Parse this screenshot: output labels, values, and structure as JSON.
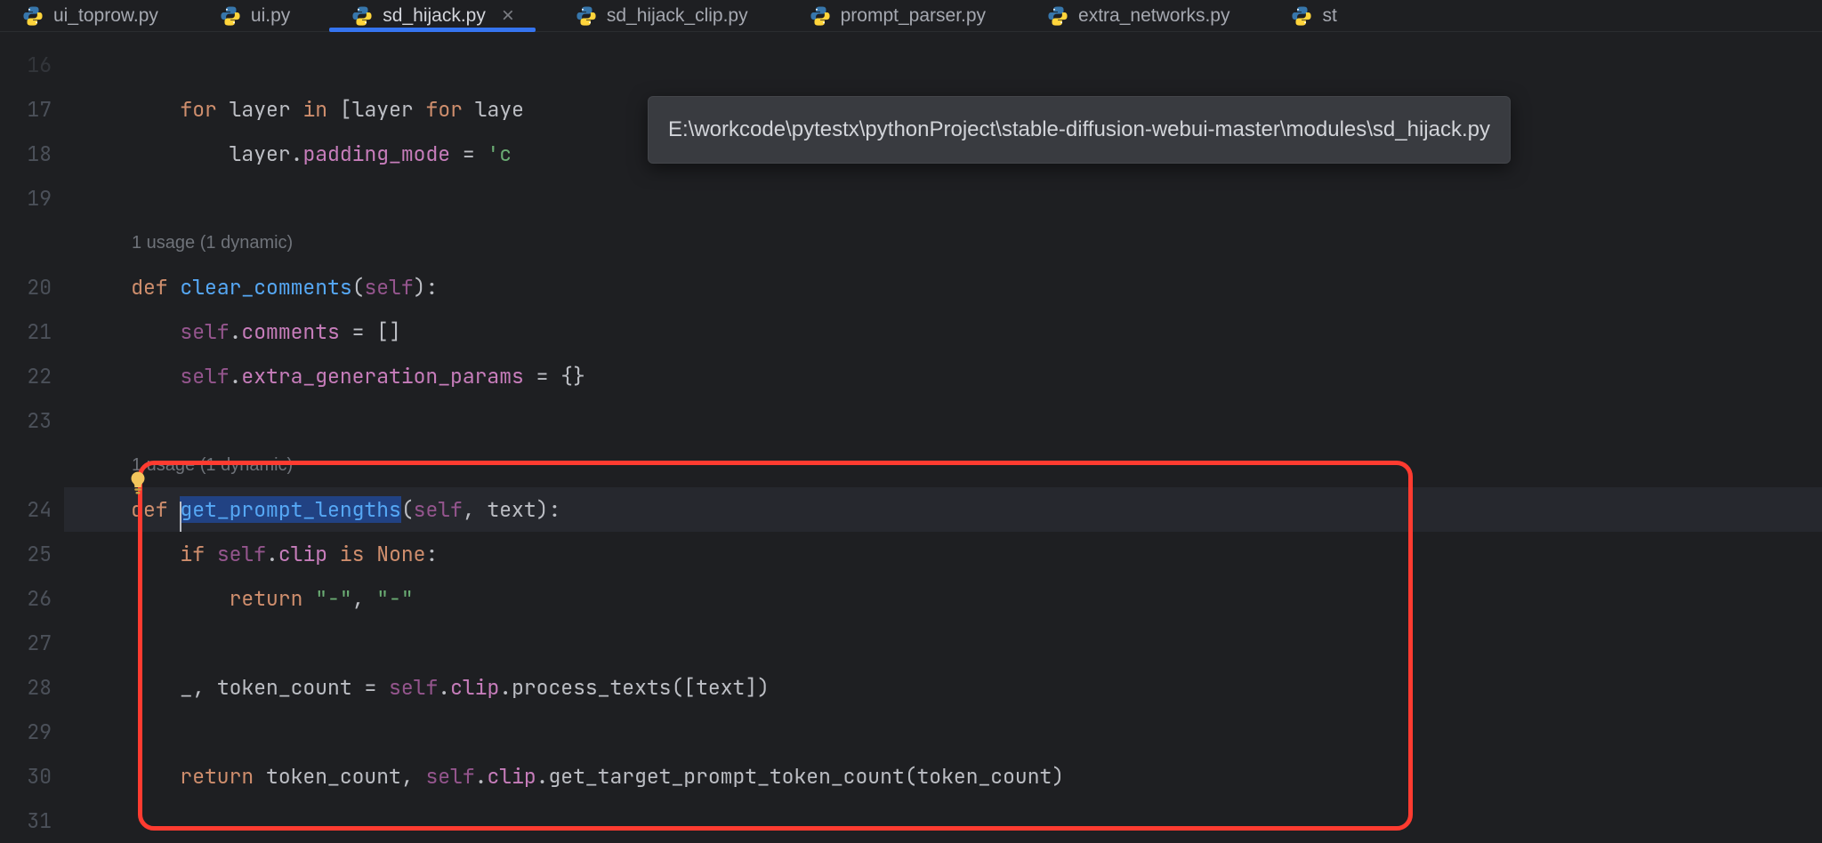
{
  "tooltip": "E:\\workcode\\pytestx\\pythonProject\\stable-diffusion-webui-master\\modules\\sd_hijack.py",
  "tabs": [
    {
      "label": "ui_toprow.py",
      "active": false,
      "closeable": false
    },
    {
      "label": "ui.py",
      "active": false,
      "closeable": false
    },
    {
      "label": "sd_hijack.py",
      "active": true,
      "closeable": true
    },
    {
      "label": "sd_hijack_clip.py",
      "active": false,
      "closeable": false
    },
    {
      "label": "prompt_parser.py",
      "active": false,
      "closeable": false
    },
    {
      "label": "extra_networks.py",
      "active": false,
      "closeable": false
    },
    {
      "label": "st",
      "active": false,
      "closeable": false
    }
  ],
  "line_numbers": [
    "16",
    "17",
    "18",
    "19",
    "",
    "20",
    "21",
    "22",
    "23",
    "",
    "24",
    "25",
    "26",
    "27",
    "28",
    "29",
    "30",
    "31"
  ],
  "usage_hint_1": "1 usage (1 dynamic)",
  "usage_hint_2": "1 usage (1 dynamic)",
  "code": {
    "l17": {
      "kw_for": "for",
      "id_layer": "layer",
      "kw_in": "in",
      "id_layer2": "layer",
      "kw_for2": "for",
      "id_layer3": "laye"
    },
    "l18": {
      "attr": "layer",
      "dot": ".",
      "attr2": "padding_mode",
      "eq": " = ",
      "str": "'c"
    },
    "l20": {
      "kw_def": "def",
      "fn": "clear_comments",
      "lp": "(",
      "self": "self",
      "rp": "):"
    },
    "l21": {
      "self": "self",
      "dot": ".",
      "attr": "comments",
      "eq": " = []"
    },
    "l22": {
      "self": "self",
      "dot": ".",
      "attr": "extra_generation_params",
      "eq": " = {}"
    },
    "l24": {
      "kw_def": "def",
      "fn": "get_prompt_lengths",
      "lp": "(",
      "self": "self",
      "comma": ", ",
      "param": "text",
      "rp": "):"
    },
    "l25": {
      "kw_if": "if",
      "self": "self",
      "dot": ".",
      "attr": "clip",
      "kw_is": "is",
      "none": "None",
      "colon": ":"
    },
    "l26": {
      "kw_return": "return",
      "s1": "\"-\"",
      "comma": ", ",
      "s2": "\"-\""
    },
    "l28": {
      "underscore": "_",
      "comma": ", ",
      "tc": "token_count",
      "eq": " = ",
      "self": "self",
      "d1": ".",
      "a1": "clip",
      "d2": ".",
      "m": "process_texts",
      "lp": "([",
      "t": "text",
      "rp": "])"
    },
    "l30": {
      "kw_return": "return",
      "tc": "token_count",
      "comma": ", ",
      "self": "self",
      "d1": ".",
      "a1": "clip",
      "d2": ".",
      "m": "get_target_prompt_token_count",
      "lp": "(",
      "arg": "token_count",
      "rp": ")"
    }
  }
}
